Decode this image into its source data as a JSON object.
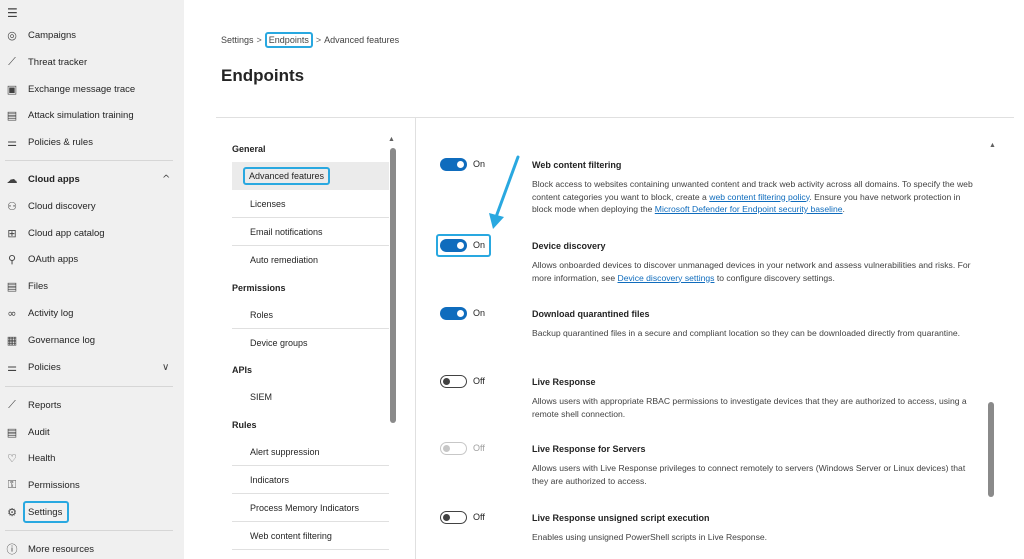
{
  "nav": {
    "menu_icon": "hamburger-icon",
    "items": [
      {
        "label": "Campaigns",
        "icon": "campaigns-icon",
        "glyph": "◎"
      },
      {
        "label": "Threat tracker",
        "icon": "chart-icon",
        "glyph": "⟋"
      },
      {
        "label": "Exchange message trace",
        "icon": "exchange-icon",
        "glyph": "▣"
      },
      {
        "label": "Attack simulation training",
        "icon": "simulation-icon",
        "glyph": "▤"
      },
      {
        "label": "Policies & rules",
        "icon": "sliders-icon",
        "glyph": "⚌"
      },
      {
        "label": "Cloud apps",
        "icon": "cloud-icon",
        "glyph": "☁",
        "chevron": "^"
      },
      {
        "label": "Cloud discovery",
        "icon": "binoculars-icon",
        "glyph": "⚇"
      },
      {
        "label": "Cloud app catalog",
        "icon": "catalog-icon",
        "glyph": "⊞"
      },
      {
        "label": "OAuth apps",
        "icon": "oauth-icon",
        "glyph": "⚲"
      },
      {
        "label": "Files",
        "icon": "files-icon",
        "glyph": "▤"
      },
      {
        "label": "Activity log",
        "icon": "glasses-icon",
        "glyph": "∞"
      },
      {
        "label": "Governance log",
        "icon": "governance-icon",
        "glyph": "▦"
      },
      {
        "label": "Policies",
        "icon": "sliders-icon",
        "glyph": "⚌",
        "chevron": "∨"
      },
      {
        "label": "Reports",
        "icon": "reports-icon",
        "glyph": "⟋"
      },
      {
        "label": "Audit",
        "icon": "audit-icon",
        "glyph": "▤"
      },
      {
        "label": "Health",
        "icon": "heart-icon",
        "glyph": "♡"
      },
      {
        "label": "Permissions",
        "icon": "key-icon",
        "glyph": "⚿"
      },
      {
        "label": "Settings",
        "icon": "gear-icon",
        "glyph": "⚙"
      },
      {
        "label": "More resources",
        "icon": "info-icon",
        "glyph": "ⓘ"
      }
    ]
  },
  "breadcrumb": {
    "items": [
      "Settings",
      "Endpoints",
      "Advanced features"
    ],
    "separator": ">"
  },
  "page": {
    "title": "Endpoints"
  },
  "subnav": {
    "sections": [
      {
        "title": "General",
        "items": [
          "Advanced features",
          "Licenses",
          "Email notifications",
          "Auto remediation"
        ]
      },
      {
        "title": "Permissions",
        "items": [
          "Roles",
          "Device groups"
        ]
      },
      {
        "title": "APIs",
        "items": [
          "SIEM"
        ]
      },
      {
        "title": "Rules",
        "items": [
          "Alert suppression",
          "Indicators",
          "Process Memory Indicators",
          "Web content filtering"
        ]
      }
    ]
  },
  "features": [
    {
      "state": "on",
      "state_label": "On",
      "title": "Web content filtering",
      "desc_parts": [
        "Block access to websites containing unwanted content and track web activity across all domains. To specify the web content categories you want to block, create a ",
        "web content filtering policy",
        ". Ensure you have network protection in block mode when deploying the ",
        "Microsoft Defender for Endpoint security baseline",
        "."
      ]
    },
    {
      "state": "on",
      "state_label": "On",
      "title": "Device discovery",
      "desc_parts": [
        "Allows onboarded devices to discover unmanaged devices in your network and assess vulnerabilities and risks. For more information, see ",
        "Device discovery settings",
        " to configure discovery settings."
      ]
    },
    {
      "state": "on",
      "state_label": "On",
      "title": "Download quarantined files",
      "desc_parts": [
        "Backup quarantined files in a secure and compliant location so they can be downloaded directly from quarantine."
      ]
    },
    {
      "state": "off",
      "state_label": "Off",
      "title": "Live Response",
      "desc_parts": [
        "Allows users with appropriate RBAC permissions to investigate devices that they are authorized to access, using a remote shell connection."
      ]
    },
    {
      "state": "disabled",
      "state_label": "Off",
      "title": "Live Response for Servers",
      "desc_parts": [
        "Allows users with Live Response privileges to connect remotely to servers (Windows Server or Linux devices) that they are authorized to access."
      ]
    },
    {
      "state": "off",
      "state_label": "Off",
      "title": "Live Response unsigned script execution",
      "desc_parts": [
        "Enables using unsigned PowerShell scripts in Live Response."
      ]
    }
  ],
  "colors": {
    "accent": "#0f6cbd",
    "highlight": "#29a8e0",
    "nav_bg": "#f0f0f0"
  }
}
